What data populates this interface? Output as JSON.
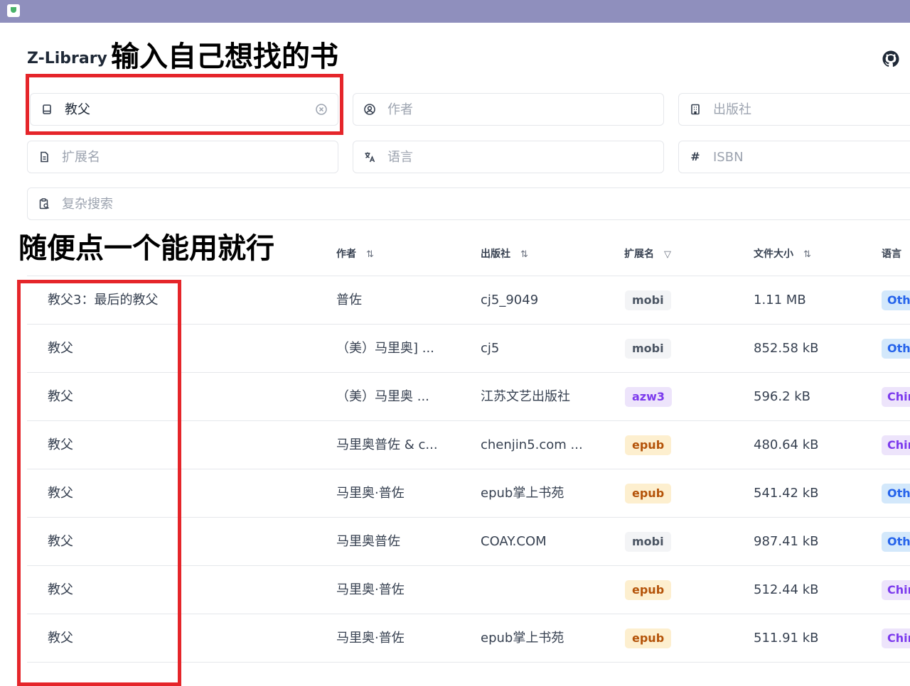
{
  "brand": "Z-Library",
  "annotations": {
    "top": "输入自己想找的书",
    "middle": "随便点一个能用就行"
  },
  "search": {
    "title_value": "教父",
    "author_placeholder": "作者",
    "publisher_placeholder": "出版社",
    "extension_placeholder": "扩展名",
    "language_placeholder": "语言",
    "isbn_placeholder": "ISBN",
    "complex_placeholder": "复杂搜索"
  },
  "columns": {
    "author": "作者",
    "publisher": "出版社",
    "extension": "扩展名",
    "filesize": "文件大小",
    "language": "语言",
    "sort_glyph": "⇅",
    "filter_glyph": "▽"
  },
  "rows": [
    {
      "title": "教父3：最后的教父",
      "author": "普佐",
      "publisher": "cj5_9049",
      "ext": "mobi",
      "size": "1.11 MB",
      "lang": "Other"
    },
    {
      "title": "教父",
      "author": "（美）马里奥] ...",
      "publisher": "cj5",
      "ext": "mobi",
      "size": "852.58 kB",
      "lang": "Other"
    },
    {
      "title": "教父",
      "author": "（美）马里奥 ...",
      "publisher": "江苏文艺出版社",
      "ext": "azw3",
      "size": "596.2 kB",
      "lang": "Chinese"
    },
    {
      "title": "教父",
      "author": "马里奥普佐 & c...",
      "publisher": "chenjin5.com ...",
      "ext": "epub",
      "size": "480.64 kB",
      "lang": "Chinese"
    },
    {
      "title": "教父",
      "author": "马里奥·普佐",
      "publisher": "epub掌上书苑",
      "ext": "epub",
      "size": "541.42 kB",
      "lang": "Other"
    },
    {
      "title": "教父",
      "author": "马里奥普佐",
      "publisher": "COAY.COM",
      "ext": "mobi",
      "size": "987.41 kB",
      "lang": "Other"
    },
    {
      "title": "教父",
      "author": "马里奥·普佐",
      "publisher": "",
      "ext": "epub",
      "size": "512.44 kB",
      "lang": "Chinese"
    },
    {
      "title": "教父",
      "author": "马里奥·普佐",
      "publisher": "epub掌上书苑",
      "ext": "epub",
      "size": "511.91 kB",
      "lang": "Chinese"
    }
  ],
  "colors": {
    "topbar": "#8f8fbd",
    "highlight": "#e5252a"
  }
}
